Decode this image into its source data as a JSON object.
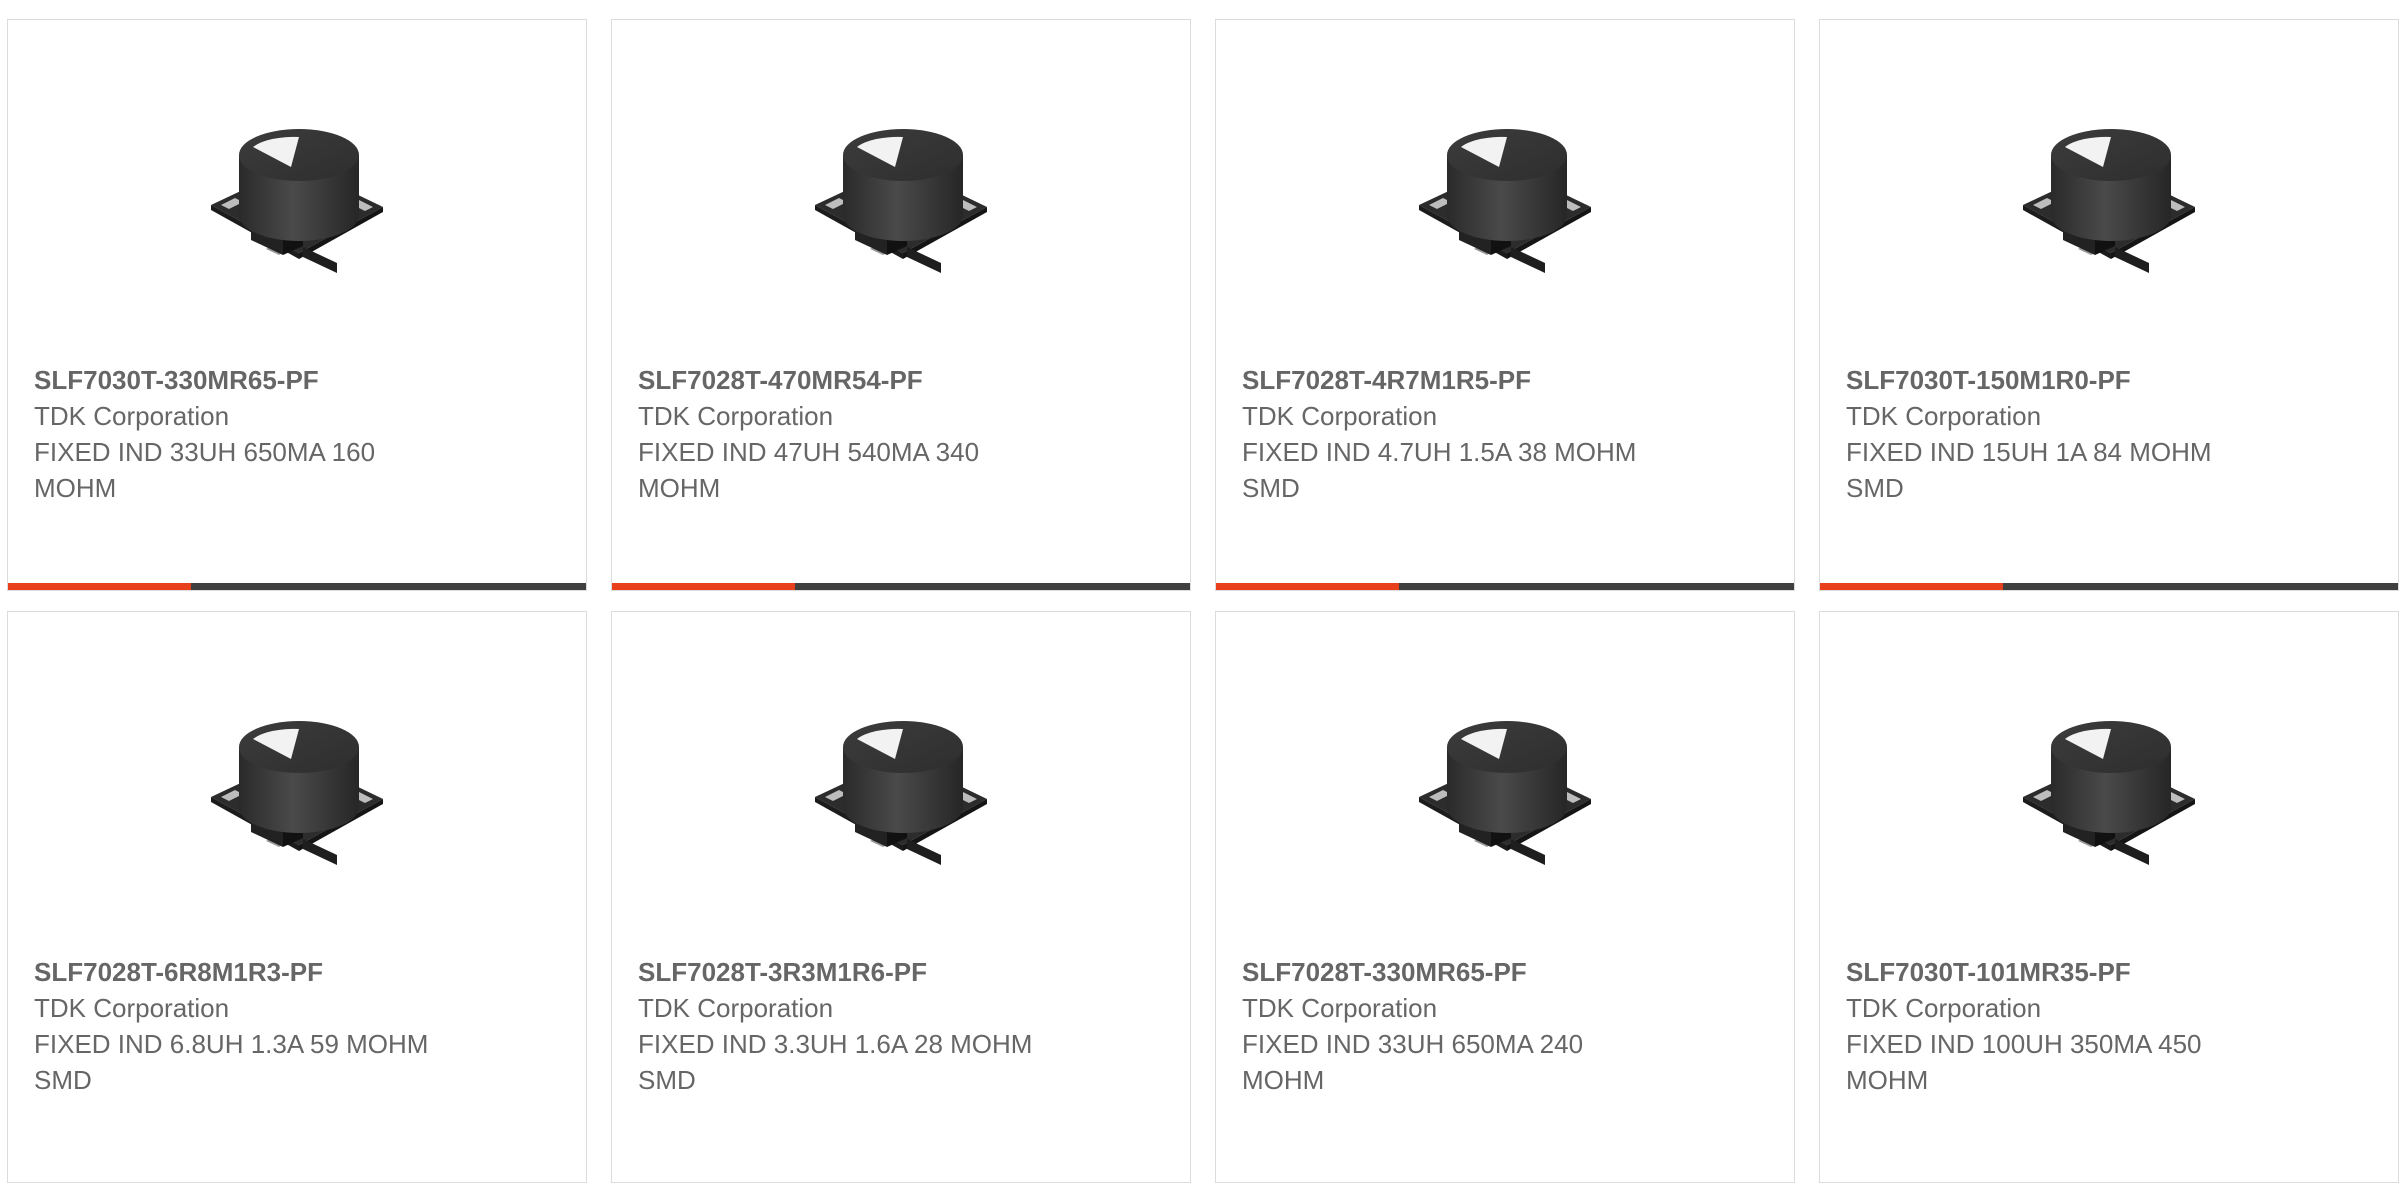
{
  "accent_color": "#e8401c",
  "bar_color": "#3f3f3f",
  "text_color": "#666666",
  "products": [
    {
      "part_number": "SLF7030T-330MR65-PF",
      "manufacturer": "TDK Corporation",
      "description": "FIXED IND 33UH 650MA 160 MOHM",
      "image_icon": "inductor-image"
    },
    {
      "part_number": "SLF7028T-470MR54-PF",
      "manufacturer": "TDK Corporation",
      "description": "FIXED IND 47UH 540MA 340 MOHM",
      "image_icon": "inductor-image"
    },
    {
      "part_number": "SLF7028T-4R7M1R5-PF",
      "manufacturer": "TDK Corporation",
      "description": "FIXED IND 4.7UH 1.5A 38 MOHM SMD",
      "image_icon": "inductor-image"
    },
    {
      "part_number": "SLF7030T-150M1R0-PF",
      "manufacturer": "TDK Corporation",
      "description": "FIXED IND 15UH 1A 84 MOHM SMD",
      "image_icon": "inductor-image"
    },
    {
      "part_number": "SLF7028T-6R8M1R3-PF",
      "manufacturer": "TDK Corporation",
      "description": "FIXED IND 6.8UH 1.3A 59 MOHM SMD",
      "image_icon": "inductor-image"
    },
    {
      "part_number": "SLF7028T-3R3M1R6-PF",
      "manufacturer": "TDK Corporation",
      "description": "FIXED IND 3.3UH 1.6A 28 MOHM SMD",
      "image_icon": "inductor-image"
    },
    {
      "part_number": "SLF7028T-330MR65-PF",
      "manufacturer": "TDK Corporation",
      "description": "FIXED IND 33UH 650MA 240 MOHM",
      "image_icon": "inductor-image"
    },
    {
      "part_number": "SLF7030T-101MR35-PF",
      "manufacturer": "TDK Corporation",
      "description": "FIXED IND 100UH 350MA 450 MOHM",
      "image_icon": "inductor-image"
    }
  ],
  "progress_fraction": 0.316
}
